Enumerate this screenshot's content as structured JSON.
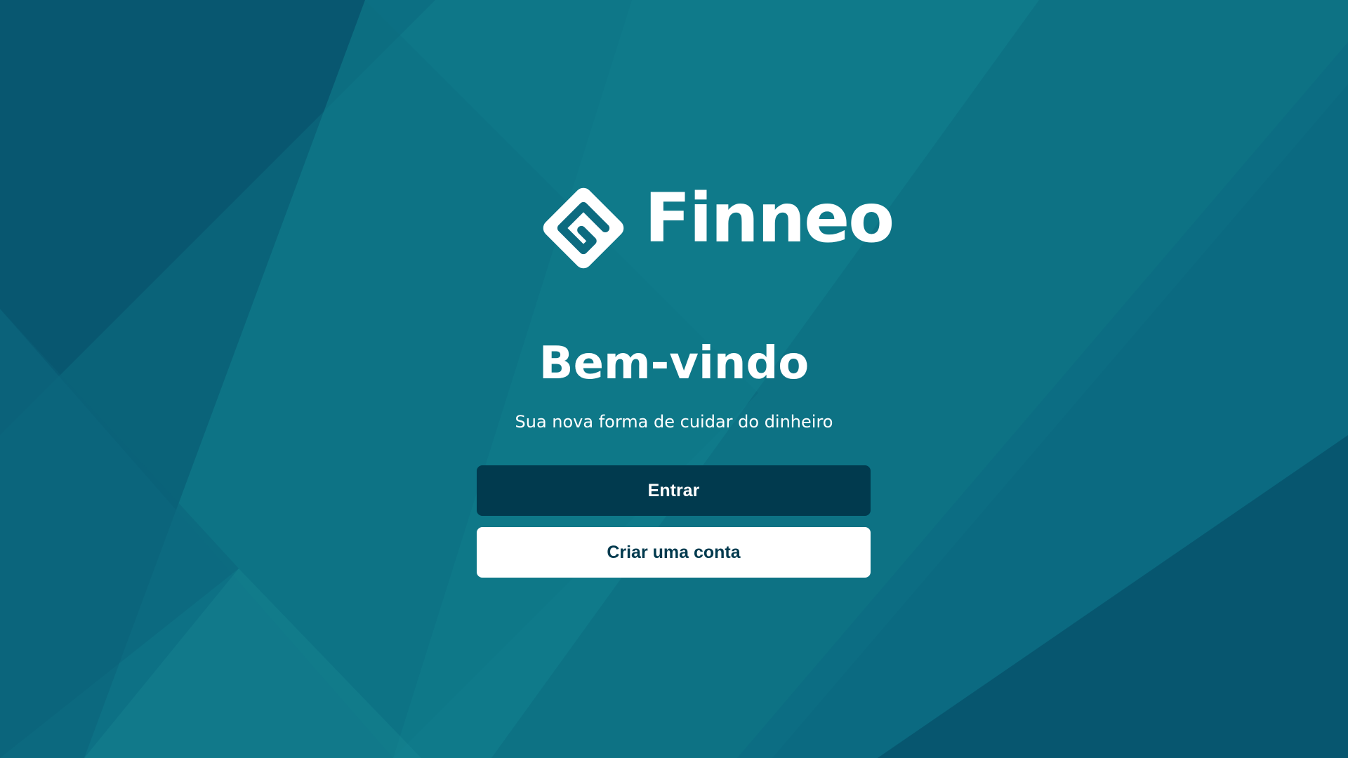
{
  "brand": {
    "name": "Finneo",
    "logo_icon": "finneo-diamond-logo-icon"
  },
  "welcome": {
    "title": "Bem-vindo",
    "subtitle": "Sua nova forma de cuidar do dinheiro"
  },
  "actions": {
    "login_label": "Entrar",
    "signup_label": "Criar uma conta"
  },
  "colors": {
    "background": "#0d6b80",
    "primary_button": "#013a4e",
    "secondary_button": "#ffffff",
    "text": "#ffffff"
  }
}
